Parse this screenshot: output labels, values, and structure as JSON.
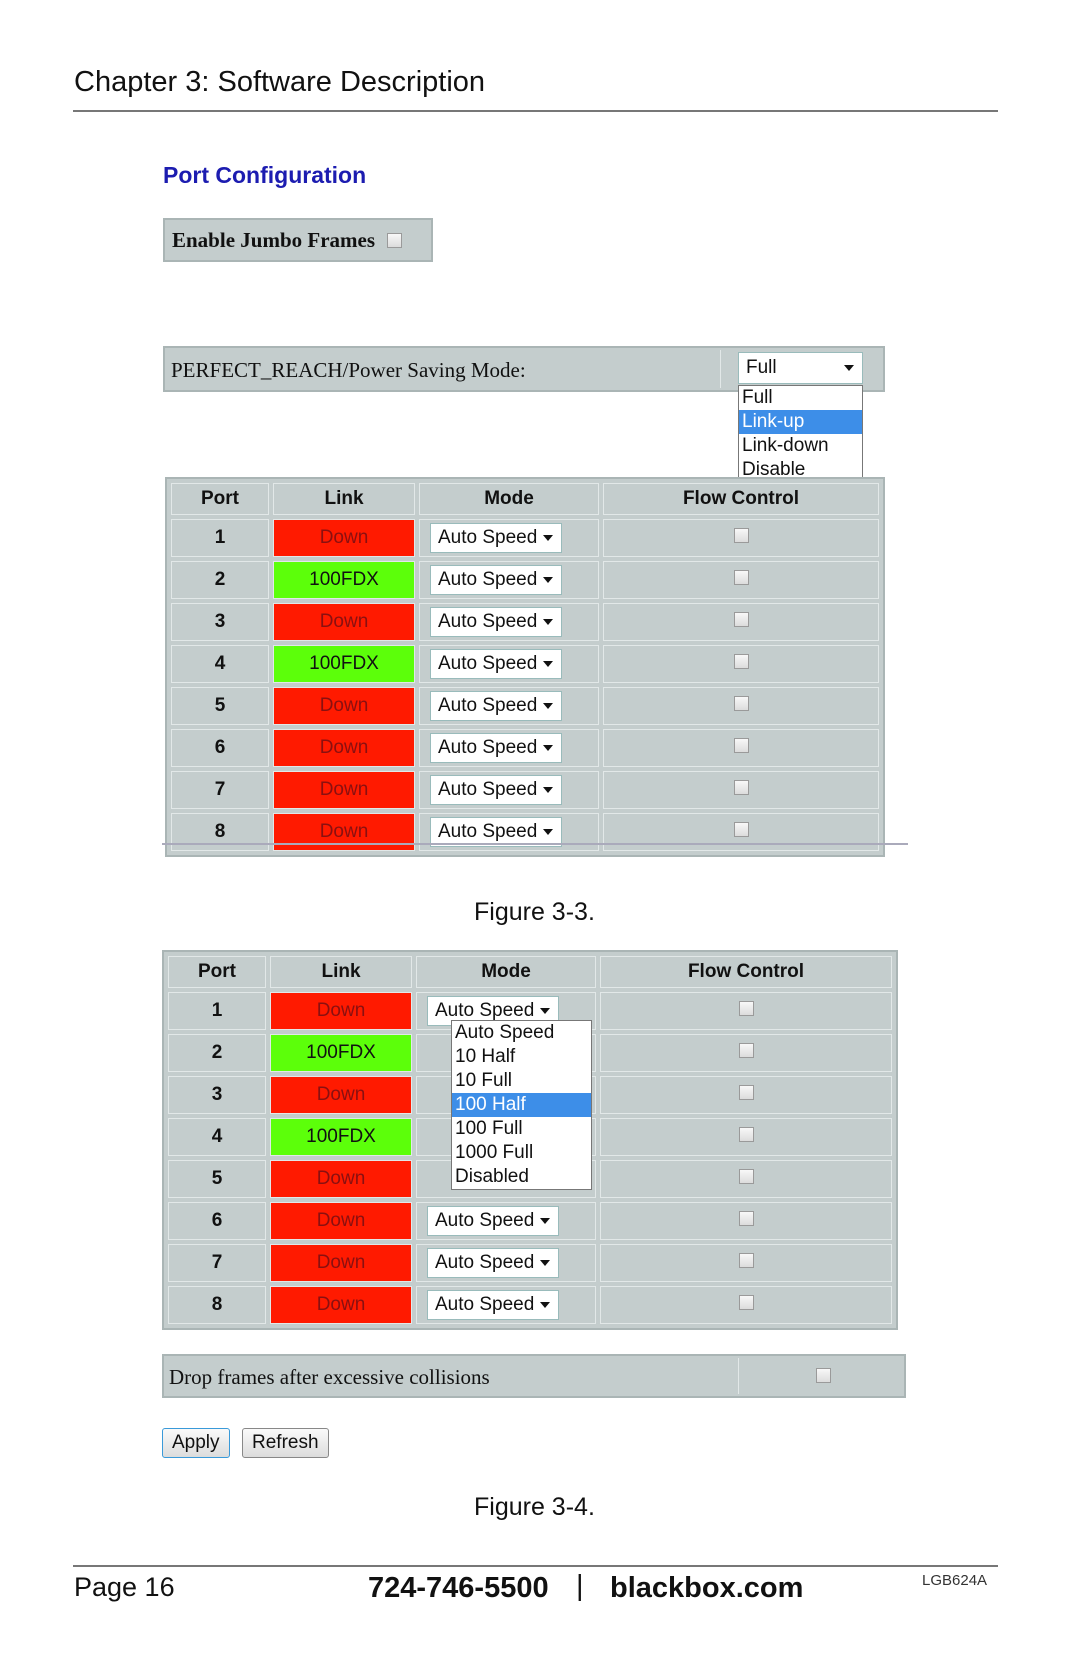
{
  "header": {
    "chapter_title": "Chapter 3: Software Description"
  },
  "port_configuration": {
    "title": "Port Configuration",
    "jumbo_frames": {
      "label": "Enable Jumbo Frames",
      "checked": false
    },
    "power_saving": {
      "label": "PERFECT_REACH/Power Saving Mode:",
      "selected": "Full",
      "options": [
        "Full",
        "Link-up",
        "Link-down",
        "Disable"
      ],
      "highlighted": "Link-up"
    }
  },
  "table_columns": [
    "Port",
    "Link",
    "Mode",
    "Flow Control"
  ],
  "figure_3_3": {
    "caption": "Figure 3-3.",
    "rows": [
      {
        "port": "1",
        "link": "Down",
        "mode": "Auto Speed",
        "flow_control": false
      },
      {
        "port": "2",
        "link": "100FDX",
        "mode": "Auto Speed",
        "flow_control": false
      },
      {
        "port": "3",
        "link": "Down",
        "mode": "Auto Speed",
        "flow_control": false
      },
      {
        "port": "4",
        "link": "100FDX",
        "mode": "Auto Speed",
        "flow_control": false
      },
      {
        "port": "5",
        "link": "Down",
        "mode": "Auto Speed",
        "flow_control": false
      },
      {
        "port": "6",
        "link": "Down",
        "mode": "Auto Speed",
        "flow_control": false
      },
      {
        "port": "7",
        "link": "Down",
        "mode": "Auto Speed",
        "flow_control": false
      },
      {
        "port": "8",
        "link": "Down",
        "mode": "Auto Speed",
        "flow_control": false
      }
    ]
  },
  "figure_3_4": {
    "caption": "Figure 3-4.",
    "rows": [
      {
        "port": "1",
        "link": "Down",
        "mode": "Auto Speed",
        "flow_control": false
      },
      {
        "port": "2",
        "link": "100FDX",
        "mode": "",
        "flow_control": false
      },
      {
        "port": "3",
        "link": "Down",
        "mode": "",
        "flow_control": false
      },
      {
        "port": "4",
        "link": "100FDX",
        "mode": "",
        "flow_control": false
      },
      {
        "port": "5",
        "link": "Down",
        "mode": "",
        "flow_control": false
      },
      {
        "port": "6",
        "link": "Down",
        "mode": "Auto Speed",
        "flow_control": false
      },
      {
        "port": "7",
        "link": "Down",
        "mode": "Auto Speed",
        "flow_control": false
      },
      {
        "port": "8",
        "link": "Down",
        "mode": "Auto Speed",
        "flow_control": false
      }
    ],
    "mode_dropdown": {
      "options": [
        "Auto Speed",
        "10 Half",
        "10 Full",
        "100 Half",
        "100 Full",
        "1000 Full",
        "Disabled"
      ],
      "highlighted": "100 Half"
    },
    "drop_frames": {
      "label": "Drop frames after excessive collisions",
      "checked": false
    },
    "buttons": {
      "apply": "Apply",
      "refresh": "Refresh"
    }
  },
  "colors": {
    "link_down": "#ff1a00",
    "link_up": "#5cff0a",
    "title_blue": "#1c1cb0",
    "panel_gray": "#c4cdcd",
    "highlight": "#3d8ee8"
  },
  "footer": {
    "page": "Page 16",
    "phone": "724-746-5500",
    "separator": "|",
    "website": "blackbox.com",
    "doc_code": "LGB624A"
  }
}
